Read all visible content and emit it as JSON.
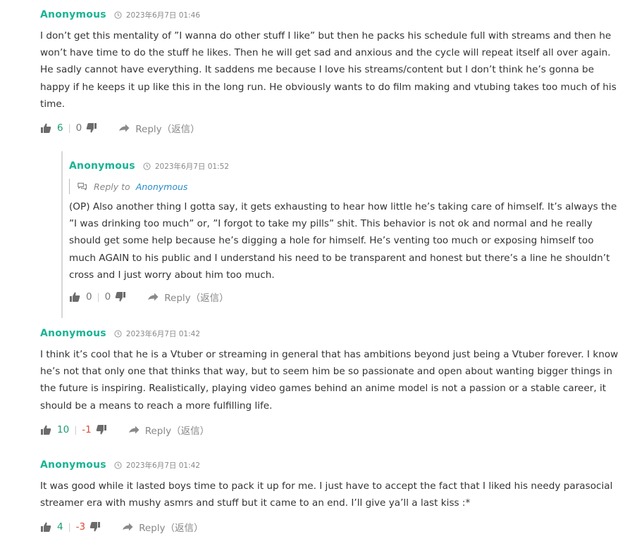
{
  "comments": [
    {
      "author": "Anonymous",
      "time": "2023年6月7日 01:46",
      "body": "I don’t get this mentality of ”I wanna do other stuff I like” but then he packs his schedule full with streams and then he won’t have time to do the stuff he likes. Then he will get sad and anxious and the cycle will repeat itself all over again. He sadly cannot have everything. It saddens me because I love his streams/content but I don’t think he’s gonna be happy if he keeps it up like this in the long run. He obviously wants to do film making and vtubing takes too much of his time.",
      "likes": "6",
      "dislikes": "0",
      "reply": "Reply（返信）"
    },
    {
      "author": "Anonymous",
      "time": "2023年6月7日 01:52",
      "reply_to_prefix": "Reply to",
      "reply_to_name": "Anonymous",
      "body": "(OP) Also another thing I gotta say, it gets exhausting to hear how little he’s taking care of himself. It’s always the ”I was drinking too much” or, ”I forgot to take my pills” shit. This behavior is not ok and normal and he really should get some help because he’s digging a hole for himself. He’s venting too much or exposing himself too much AGAIN to his public and I understand his need to be transparent and honest but there’s a line he shouldn’t cross and I just worry about him too much.",
      "likes": "0",
      "dislikes": "0",
      "reply": "Reply（返信）"
    },
    {
      "author": "Anonymous",
      "time": "2023年6月7日 01:42",
      "body": "I think it’s cool that he is a Vtuber or streaming in general that has ambitions beyond just being a Vtuber forever. I know he’s not that only one that thinks that way, but to seem him be so passionate and open about wanting bigger things in the future is inspiring. Realistically, playing video games behind an anime model is not a passion or a stable career, it should be a means to reach a more fulfilling life.",
      "likes": "10",
      "dislikes": "-1",
      "reply": "Reply（返信）"
    },
    {
      "author": "Anonymous",
      "time": "2023年6月7日 01:42",
      "body": "It was good while it lasted boys time to pack it up for me. I just have to accept the fact that I liked his needy parasocial streamer era with mushy asmrs and stuff but it came to an end. I’ll give ya’ll a last kiss :*",
      "likes": "4",
      "dislikes": "-3",
      "reply": "Reply（返信）"
    }
  ],
  "colors": {
    "author": "#1ab394",
    "positive": "#1a9e6e",
    "negative": "#e14a36",
    "link": "#2a8cc9"
  },
  "icons": [
    "clock-icon",
    "thumbs-up-icon",
    "thumbs-down-icon",
    "reply-arrow-icon",
    "chat-bubbles-icon"
  ]
}
